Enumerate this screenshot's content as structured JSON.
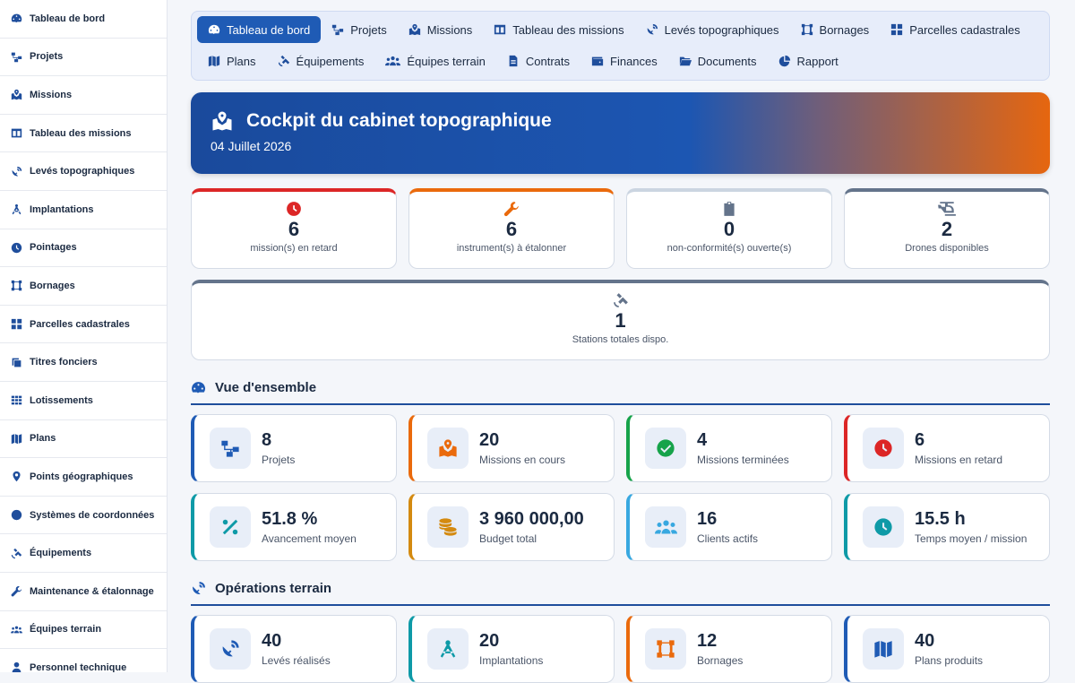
{
  "sidebar": {
    "items": [
      {
        "label": "Tableau de bord",
        "icon": "gauge-icon"
      },
      {
        "label": "Projets",
        "icon": "sitemap-icon"
      },
      {
        "label": "Missions",
        "icon": "map-location-icon"
      },
      {
        "label": "Tableau des missions",
        "icon": "table-icon"
      },
      {
        "label": "Levés topographiques",
        "icon": "satellite-dish-icon"
      },
      {
        "label": "Implantations",
        "icon": "compass-drafting-icon"
      },
      {
        "label": "Pointages",
        "icon": "clock-icon"
      },
      {
        "label": "Bornages",
        "icon": "vector-square-icon"
      },
      {
        "label": "Parcelles cadastrales",
        "icon": "grid-icon"
      },
      {
        "label": "Titres fonciers",
        "icon": "copy-icon"
      },
      {
        "label": "Lotissements",
        "icon": "grid-small-icon"
      },
      {
        "label": "Plans",
        "icon": "map-icon"
      },
      {
        "label": "Points géographiques",
        "icon": "map-pin-icon"
      },
      {
        "label": "Systèmes de coordonnées",
        "icon": "globe-icon"
      },
      {
        "label": "Équipements",
        "icon": "satellite-icon"
      },
      {
        "label": "Maintenance & étalonnage",
        "icon": "wrench-icon"
      },
      {
        "label": "Équipes terrain",
        "icon": "users-icon"
      },
      {
        "label": "Personnel technique",
        "icon": "user-icon"
      }
    ]
  },
  "topnav": {
    "items": [
      {
        "label": "Tableau de bord",
        "active": true
      },
      {
        "label": "Projets"
      },
      {
        "label": "Missions"
      },
      {
        "label": "Tableau des missions"
      },
      {
        "label": "Levés topographiques"
      },
      {
        "label": "Bornages"
      },
      {
        "label": "Parcelles cadastrales"
      },
      {
        "label": "Plans"
      },
      {
        "label": "Équipements"
      },
      {
        "label": "Équipes terrain"
      },
      {
        "label": "Contrats"
      },
      {
        "label": "Finances"
      },
      {
        "label": "Documents"
      },
      {
        "label": "Rapport"
      }
    ]
  },
  "hero": {
    "title": "Cockpit du cabinet topographique",
    "date": "04 Juillet 2026"
  },
  "alerts": [
    {
      "value": "6",
      "label": "mission(s) en retard",
      "color": "#dc2626",
      "icon": "clock-icon"
    },
    {
      "value": "6",
      "label": "instrument(s) à étalonner",
      "color": "#ea6a0c",
      "icon": "wrench-icon"
    },
    {
      "value": "0",
      "label": "non-conformité(s) ouverte(s)",
      "color": "#cbd5e1",
      "icon": "clipboard-check-icon"
    },
    {
      "value": "2",
      "label": "Drones disponibles",
      "color": "#64748b",
      "icon": "helicopter-icon"
    },
    {
      "value": "1",
      "label": "Stations totales dispo.",
      "color": "#64748b",
      "icon": "satellite-icon"
    }
  ],
  "overview": {
    "title": "Vue d'ensemble",
    "stats": [
      {
        "value": "8",
        "label": "Projets",
        "color": "#1f5bb5",
        "icon": "sitemap-icon"
      },
      {
        "value": "20",
        "label": "Missions en cours",
        "color": "#ea6a0c",
        "icon": "map-location-icon"
      },
      {
        "value": "4",
        "label": "Missions terminées",
        "color": "#16a34a",
        "icon": "check-circle-icon"
      },
      {
        "value": "6",
        "label": "Missions en retard",
        "color": "#dc2626",
        "icon": "clock-icon"
      },
      {
        "value": "51.8 %",
        "label": "Avancement moyen",
        "color": "#0e9aa7",
        "icon": "percent-icon"
      },
      {
        "value": "3 960 000,00",
        "label": "Budget total",
        "color": "#d48a10",
        "icon": "coins-icon"
      },
      {
        "value": "16",
        "label": "Clients actifs",
        "color": "#38a8e0",
        "icon": "users-icon"
      },
      {
        "value": "15.5 h",
        "label": "Temps moyen / mission",
        "color": "#0e9aa7",
        "icon": "clock-icon"
      }
    ]
  },
  "field": {
    "title": "Opérations terrain",
    "stats": [
      {
        "value": "40",
        "label": "Levés réalisés",
        "color": "#1f5bb5",
        "icon": "satellite-dish-icon"
      },
      {
        "value": "20",
        "label": "Implantations",
        "color": "#0e9aa7",
        "icon": "compass-drafting-icon"
      },
      {
        "value": "12",
        "label": "Bornages",
        "color": "#ea6a0c",
        "icon": "vector-square-icon"
      },
      {
        "value": "40",
        "label": "Plans produits",
        "color": "#1f5bb5",
        "icon": "map-icon"
      }
    ]
  }
}
